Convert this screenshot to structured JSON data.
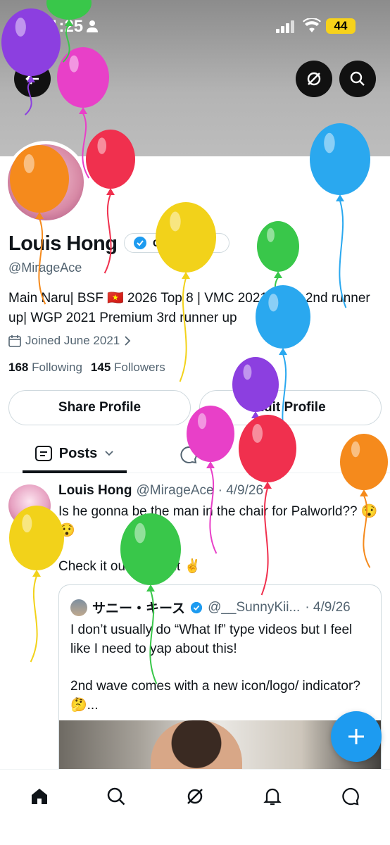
{
  "status_bar": {
    "time": "1:25",
    "battery": "44"
  },
  "profile": {
    "name": "Louis Hong",
    "verified_label": "Get verified",
    "handle": "@MirageAce",
    "bio": "Main Naru| BSF 🇻🇳 2026 Top 8 | VMC 2021-2022 2nd runner up| WGP 2021 Premium 3rd runner up",
    "joined": "Joined June 2021",
    "following_count": "168",
    "following_label": "Following",
    "followers_count": "145",
    "followers_label": "Followers",
    "share_button": "Share Profile",
    "edit_button": "Edit Profile"
  },
  "tabs": {
    "posts": "Posts"
  },
  "tweet": {
    "name": "Louis Hong",
    "handle": "@MirageAce",
    "date": "· 4/9/26",
    "text": "Is he gonna be the man in the chair for Palworld?? 😯😯",
    "text2": "Check it out, find out ✌️",
    "quote": {
      "name": "サニー・キース",
      "handle": "@__SunnyKii...",
      "date": "· 4/9/26",
      "text": "I don’t usually do “What If” type videos but I feel like I need to yap about this!",
      "text2": "2nd wave comes with a new icon/logo/ indicator? 🤔..."
    }
  },
  "colors": {
    "accent": "#1d9bf0",
    "text": "#0f1419",
    "muted": "#536471"
  },
  "icons": [
    "person-icon",
    "signal-icon",
    "wifi-icon",
    "back-icon",
    "grok-icon",
    "search-icon",
    "verified-icon",
    "calendar-icon",
    "chevron-right-icon",
    "posts-icon",
    "chevron-down-icon",
    "plus-icon",
    "home-icon",
    "bell-icon",
    "messages-icon"
  ]
}
